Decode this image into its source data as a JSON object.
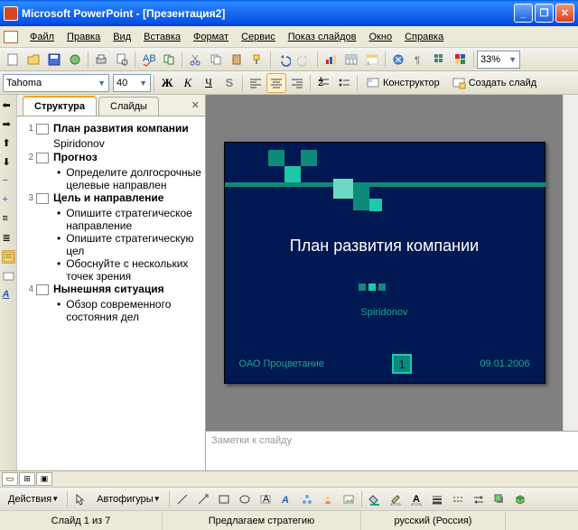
{
  "title": "Microsoft PowerPoint - [Презентация2]",
  "menu": {
    "file": "Файл",
    "edit": "Правка",
    "view": "Вид",
    "insert": "Вставка",
    "format": "Формат",
    "service": "Сервис",
    "slideshow": "Показ слайдов",
    "window": "Окно",
    "help": "Справка"
  },
  "format_bar": {
    "font": "Tahoma",
    "size": "40",
    "designer": "Конструктор",
    "new_slide": "Создать слайд"
  },
  "zoom": "33%",
  "tabs": {
    "structure": "Структура",
    "slides": "Слайды"
  },
  "outline": [
    {
      "n": "1",
      "title": "План развития компании",
      "sub": "Spiridonov"
    },
    {
      "n": "2",
      "title": "Прогноз",
      "bullets": [
        "Определите долгосрочные целевые направлен"
      ]
    },
    {
      "n": "3",
      "title": "Цель и направление",
      "bullets": [
        "Опишите стратегическое направление",
        "Опишите стратегическую цел",
        "Обоснуйте с нескольких точек зрения"
      ]
    },
    {
      "n": "4",
      "title": "Нынешняя ситуация",
      "bullets": [
        "Обзор современного состояния дел"
      ]
    }
  ],
  "slide": {
    "title": "План развития компании",
    "subtitle": "Spiridonov",
    "footer_left": "ОАО Процветание",
    "page": "1",
    "date": "09.01.2006"
  },
  "notes_placeholder": "Заметки к слайду",
  "drawbar": {
    "actions": "Действия",
    "autoshapes": "Автофигуры"
  },
  "status": {
    "slide": "Слайд 1 из 7",
    "center": "Предлагаем стратегию",
    "lang": "русский (Россия)"
  }
}
